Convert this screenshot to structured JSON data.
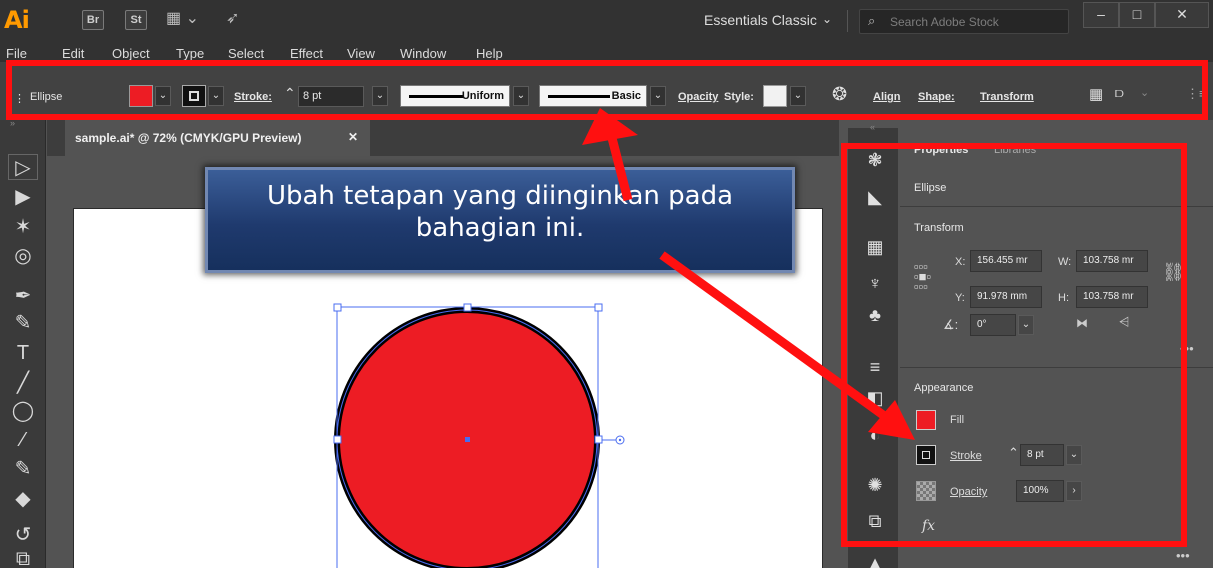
{
  "app": {
    "logo": "Ai",
    "bridge_label": "Br",
    "stock_label": "St",
    "layout_icon": "layout-icon",
    "gpu_icon": "rocket-icon",
    "workspace": "Essentials Classic",
    "search_placeholder": "Search Adobe Stock",
    "window_controls": [
      "–",
      "□",
      "✕"
    ]
  },
  "menubar": {
    "items": [
      "File",
      "Edit",
      "Object",
      "Type",
      "Select",
      "Effect",
      "View",
      "Window",
      "Help"
    ]
  },
  "controlbar": {
    "object_type": "Ellipse",
    "fill_color": "#ed1c24",
    "stroke_label": "Stroke:",
    "stroke_weight": "8 pt",
    "variable_width_profile": "Uniform",
    "brush_definition": "Basic",
    "opacity_label": "Opacity",
    "style_label": "Style:",
    "align_label": "Align",
    "shape_label": "Shape:",
    "transform_label": "Transform"
  },
  "document": {
    "tab_title": "sample.ai* @ 72% (CMYK/GPU Preview)",
    "close_glyph": "✕",
    "ellipse_fill": "#ed1c24",
    "ellipse_stroke": "#000000"
  },
  "callout": {
    "line1": "Ubah tetapan yang diinginkan pada",
    "line2": "bahagian ini."
  },
  "properties": {
    "tab_properties": "Properties",
    "tab_libraries": "Libraries",
    "object_type": "Ellipse",
    "transform_title": "Transform",
    "x_label": "X:",
    "x_value": "156.455 mr",
    "y_label": "Y:",
    "y_value": "91.978 mm",
    "w_label": "W:",
    "w_value": "103.758 mr",
    "h_label": "H:",
    "h_value": "103.758 mr",
    "angle_value": "0°",
    "appearance_title": "Appearance",
    "fill_label": "Fill",
    "stroke_label": "Stroke",
    "stroke_weight": "8 pt",
    "opacity_label": "Opacity",
    "opacity_value": "100%",
    "fx_label": "fx"
  },
  "colors": {
    "highlight": "#ff1010",
    "fill_red": "#ed1c24",
    "callout_blue": "#1f3a6e"
  }
}
